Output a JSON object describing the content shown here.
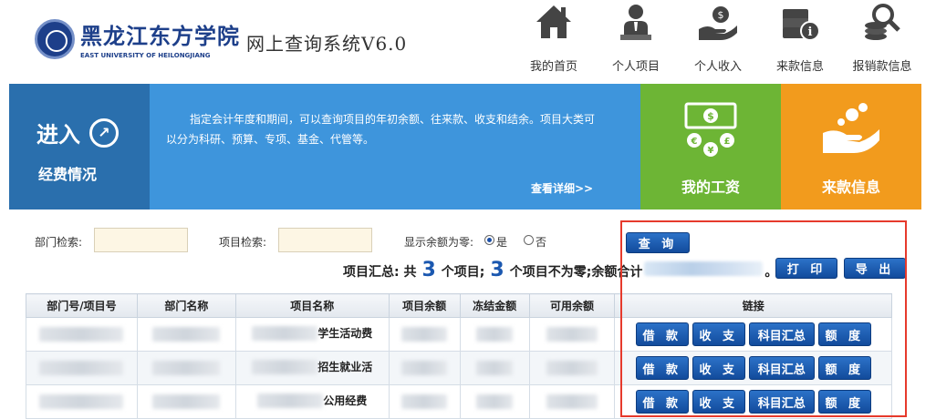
{
  "header": {
    "logo_cn": "黑龙江东方学院",
    "logo_en": "EAST UNIVERSITY OF HEILONGJIANG",
    "system_title": "网上查询系统V6.0",
    "nav": [
      {
        "label": "我的首页",
        "icon": "home-icon"
      },
      {
        "label": "个人项目",
        "icon": "person-icon"
      },
      {
        "label": "个人收入",
        "icon": "hand-coin-icon"
      },
      {
        "label": "来款信息",
        "icon": "money-info-icon"
      },
      {
        "label": "报销款信息",
        "icon": "coins-search-icon"
      }
    ]
  },
  "banner": {
    "enter_title": "进入",
    "enter_arrow": "↗",
    "enter_sub": "经费情况",
    "description": "指定会计年度和期间，可以查询项目的年初余额、往来款、收支和结余。项目大类可以分为科研、预算、专项、基金、代管等。",
    "more_link": "查看详细>>",
    "salary_label": "我的工资",
    "income_label": "来款信息"
  },
  "colors": {
    "enter_bg": "#2a6fad",
    "desc_bg": "#3e95dc",
    "salary_bg": "#6db535",
    "income_bg": "#f29b1d",
    "button": "#1a5cb4",
    "highlight_box": "#e63a2c"
  },
  "search": {
    "dept_label": "部门检索:",
    "dept_value": "",
    "project_label": "项目检索:",
    "project_value": "",
    "zero_label": "显示余额为零:",
    "option_yes": "是",
    "option_no": "否",
    "zero_selected": "是",
    "query_button": "查 询",
    "print_button": "打 印",
    "export_button": "导 出"
  },
  "summary": {
    "prefix": "项目汇总: 共",
    "total_count": "3",
    "mid1": "个项目;",
    "nonzero_count": "3",
    "mid2": "个项目不为零;余额合计",
    "end": "。"
  },
  "table": {
    "columns": [
      "部门号/项目号",
      "部门名称",
      "项目名称",
      "项目余额",
      "冻结金额",
      "可用余额",
      "链接"
    ],
    "rows": [
      {
        "project_suffix": "学生活动费"
      },
      {
        "project_suffix": "招生就业活"
      },
      {
        "project_suffix": "公用经费"
      }
    ],
    "actions": [
      "借 款",
      "收 支",
      "科目汇总",
      "额 度"
    ]
  }
}
